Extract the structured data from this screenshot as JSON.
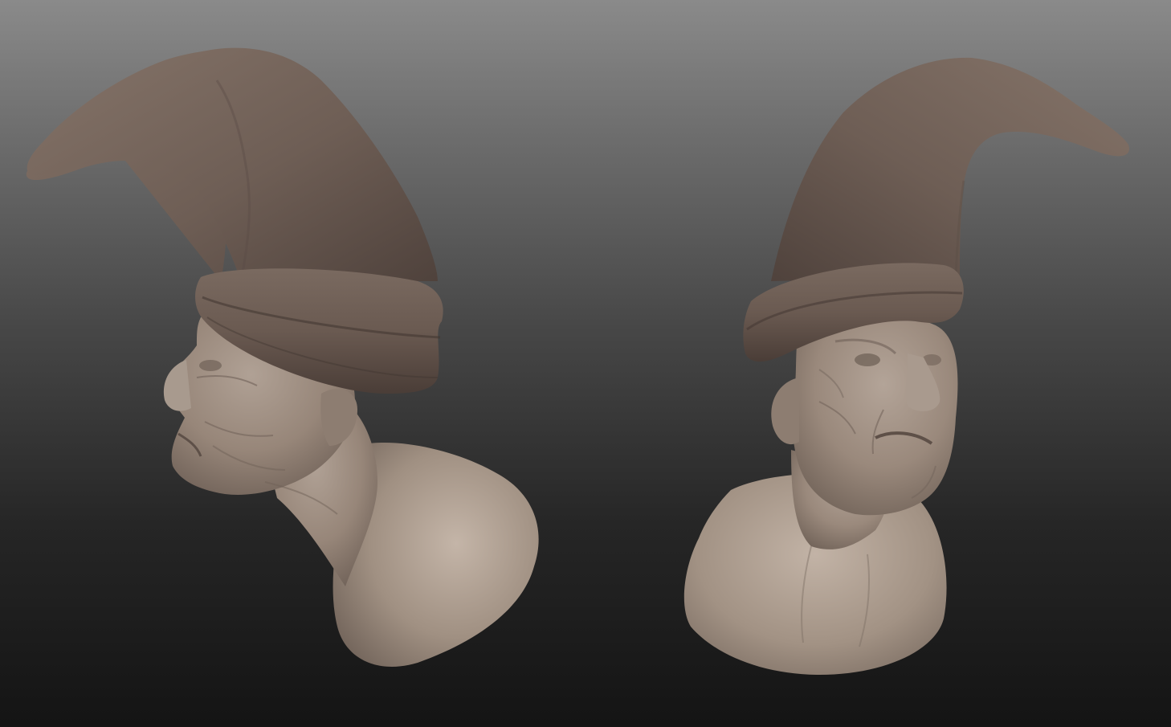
{
  "scene": {
    "background_top_color": "#8a8a8a",
    "background_bottom_color": "#141414",
    "material_skin_color": "#9b8b7f",
    "material_hat_color": "#6a5b54"
  },
  "views": [
    {
      "id": "profile",
      "description_icon": "bust-profile-icon"
    },
    {
      "id": "three-quarter",
      "description_icon": "bust-three-quarter-icon"
    }
  ]
}
